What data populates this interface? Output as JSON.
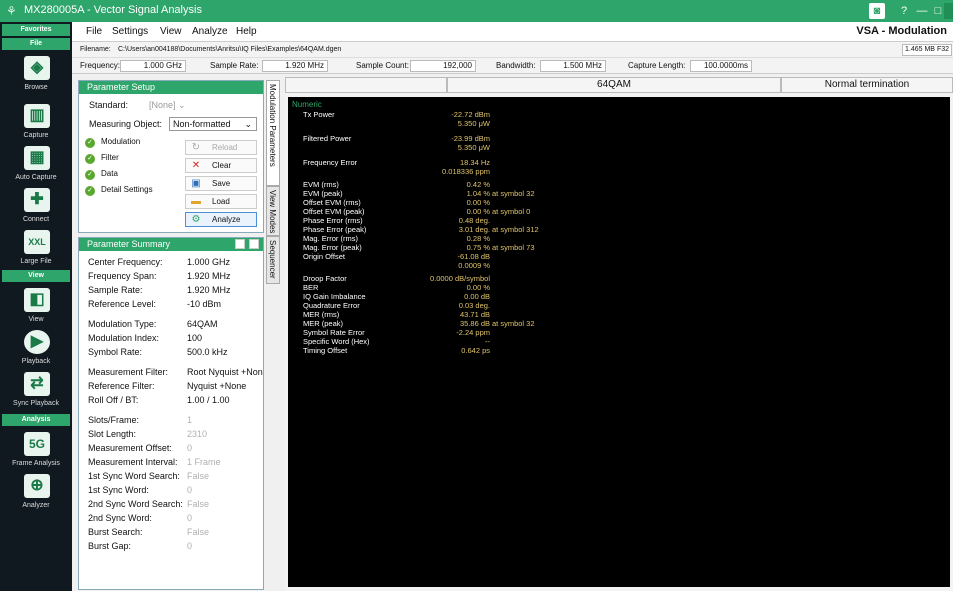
{
  "window": {
    "title": "MX280005A - Vector Signal Analysis",
    "controls": {
      "help": "?",
      "minimize": "—",
      "maximize": "□"
    }
  },
  "menubar": {
    "items": [
      "File",
      "Settings",
      "View",
      "Analyze",
      "Help"
    ],
    "app_name": "VSA - Modulation"
  },
  "sidebar": {
    "sections": {
      "favorites": "Favorites",
      "file": "File",
      "view": "View",
      "analysis": "Analysis"
    },
    "file_items": [
      {
        "label": "Browse",
        "icon": "browse-icon"
      },
      {
        "label": "Capture",
        "icon": "capture-icon"
      },
      {
        "label": "Auto Capture",
        "icon": "auto-capture-icon"
      },
      {
        "label": "Connect",
        "icon": "connect-icon"
      },
      {
        "label": "Large File",
        "icon": "large-file-icon",
        "glyph": "XXL"
      }
    ],
    "view_items": [
      {
        "label": "View",
        "icon": "view-icon"
      },
      {
        "label": "Playback",
        "icon": "playback-icon"
      },
      {
        "label": "Sync Playback",
        "icon": "sync-playback-icon"
      }
    ],
    "analysis_items": [
      {
        "label": "Frame Analysis",
        "icon": "frame-analysis-icon",
        "glyph": "5G"
      },
      {
        "label": "Analyzer",
        "icon": "analyzer-icon"
      }
    ]
  },
  "filebar": {
    "label": "Filename:",
    "path": "C:\\Users\\an004188\\Documents\\Anritsu\\IQ Files\\Examples\\64QAM.dgen",
    "memory": "1.465 MB",
    "format": "F32"
  },
  "parambar": {
    "frequency_label": "Frequency:",
    "frequency": "1.000 GHz",
    "sample_rate_label": "Sample Rate:",
    "sample_rate": "1.920 MHz",
    "sample_count_label": "Sample Count:",
    "sample_count": "192,000",
    "bandwidth_label": "Bandwidth:",
    "bandwidth": "1.500 MHz",
    "capture_length_label": "Capture Length:",
    "capture_length": "100.0000ms"
  },
  "setup": {
    "title": "Parameter Setup",
    "standard_label": "Standard:",
    "standard_value": "[None]",
    "measuring_object_label": "Measuring Object:",
    "measuring_object_value": "Non-formatted",
    "checks": [
      "Modulation",
      "Filter",
      "Data",
      "Detail Settings"
    ],
    "buttons": {
      "reload": "Reload",
      "clear": "Clear",
      "save": "Save",
      "load": "Load",
      "analyze": "Analyze"
    }
  },
  "vertical_tabs": [
    "Modulation Parameters",
    "View Modes",
    "Sequencer"
  ],
  "summary": {
    "title": "Parameter Summary",
    "rows": [
      {
        "k": "Center Frequency:",
        "v": "1.000 GHz"
      },
      {
        "k": "Frequency Span:",
        "v": "1.920 MHz"
      },
      {
        "k": "Sample Rate:",
        "v": "1.920 MHz"
      },
      {
        "k": "Reference Level:",
        "v": "-10 dBm"
      },
      {
        "k": "Modulation Type:",
        "v": "64QAM"
      },
      {
        "k": "Modulation Index:",
        "v": "100"
      },
      {
        "k": "Symbol Rate:",
        "v": "500.0 kHz"
      },
      {
        "k": "Measurement Filter:",
        "v": "Root Nyquist +None"
      },
      {
        "k": "Reference Filter:",
        "v": "Nyquist +None"
      },
      {
        "k": "Roll Off / BT:",
        "v": "1.00 / 1.00"
      },
      {
        "k": "Slots/Frame:",
        "v": "1",
        "dis": true
      },
      {
        "k": "Slot Length:",
        "v": "2310",
        "dis": true
      },
      {
        "k": "Measurement Offset:",
        "v": "0",
        "dis": true
      },
      {
        "k": "Measurement Interval:",
        "v": "1 Frame",
        "dis": true
      },
      {
        "k": "1st Sync Word Search:",
        "v": "False",
        "dis": true
      },
      {
        "k": "1st Sync Word:",
        "v": "0",
        "dis": true
      },
      {
        "k": "2nd Sync Word Search:",
        "v": "False",
        "dis": true
      },
      {
        "k": "2nd Sync Word:",
        "v": "0",
        "dis": true
      },
      {
        "k": "Burst Search:",
        "v": "False",
        "dis": true
      },
      {
        "k": "Burst Gap:",
        "v": "0",
        "dis": true
      }
    ]
  },
  "result": {
    "header_modulation": "64QAM",
    "header_termination": "Normal termination",
    "section": "Numeric",
    "rows": [
      {
        "k": "Tx Power",
        "v": "-22.72 dBm",
        "s": ""
      },
      {
        "k": "",
        "v": "5.350 μW",
        "s": ""
      },
      {
        "k": "Filtered Power",
        "v": "-23.99 dBm",
        "s": ""
      },
      {
        "k": "",
        "v": "5.350 μW",
        "s": ""
      },
      {
        "k": "Frequency Error",
        "v": "18.34 Hz",
        "s": ""
      },
      {
        "k": "",
        "v": "0.018336 ppm",
        "s": ""
      },
      {
        "k": "EVM (rms)",
        "v": "0.42 %",
        "s": ""
      },
      {
        "k": "EVM (peak)",
        "v": "1.04 %",
        "s": "at symbol 32"
      },
      {
        "k": "Offset EVM (rms)",
        "v": "0.00 %",
        "s": ""
      },
      {
        "k": "Offset EVM (peak)",
        "v": "0.00 %",
        "s": "at symbol 0"
      },
      {
        "k": "Phase Error (rms)",
        "v": "0.48 deg.",
        "s": ""
      },
      {
        "k": "Phase Error (peak)",
        "v": "3.01 deg.",
        "s": "at symbol 312"
      },
      {
        "k": "Mag. Error (rms)",
        "v": "0.28 %",
        "s": ""
      },
      {
        "k": "Mag. Error (peak)",
        "v": "0.75 %",
        "s": "at symbol 73"
      },
      {
        "k": "Origin Offset",
        "v": "-61.08 dB",
        "s": ""
      },
      {
        "k": "",
        "v": "0.0009 %",
        "s": ""
      },
      {
        "k": "Droop Factor",
        "v": "0.0000 dB/symbol",
        "s": ""
      },
      {
        "k": "BER",
        "v": "0.00 %",
        "s": ""
      },
      {
        "k": "IQ Gain Imbalance",
        "v": "0.00 dB",
        "s": ""
      },
      {
        "k": "Quadrature Error",
        "v": "0.03 deg.",
        "s": ""
      },
      {
        "k": "MER (rms)",
        "v": "43.71 dB",
        "s": ""
      },
      {
        "k": "MER (peak)",
        "v": "35.86 dB",
        "s": "at symbol 32"
      },
      {
        "k": "Symbol Rate Error",
        "v": "-2.24 ppm",
        "s": ""
      },
      {
        "k": "Specific Word (Hex)",
        "v": "--",
        "s": ""
      },
      {
        "k": "Timing Offset",
        "v": "0.642 ps",
        "s": ""
      }
    ]
  }
}
